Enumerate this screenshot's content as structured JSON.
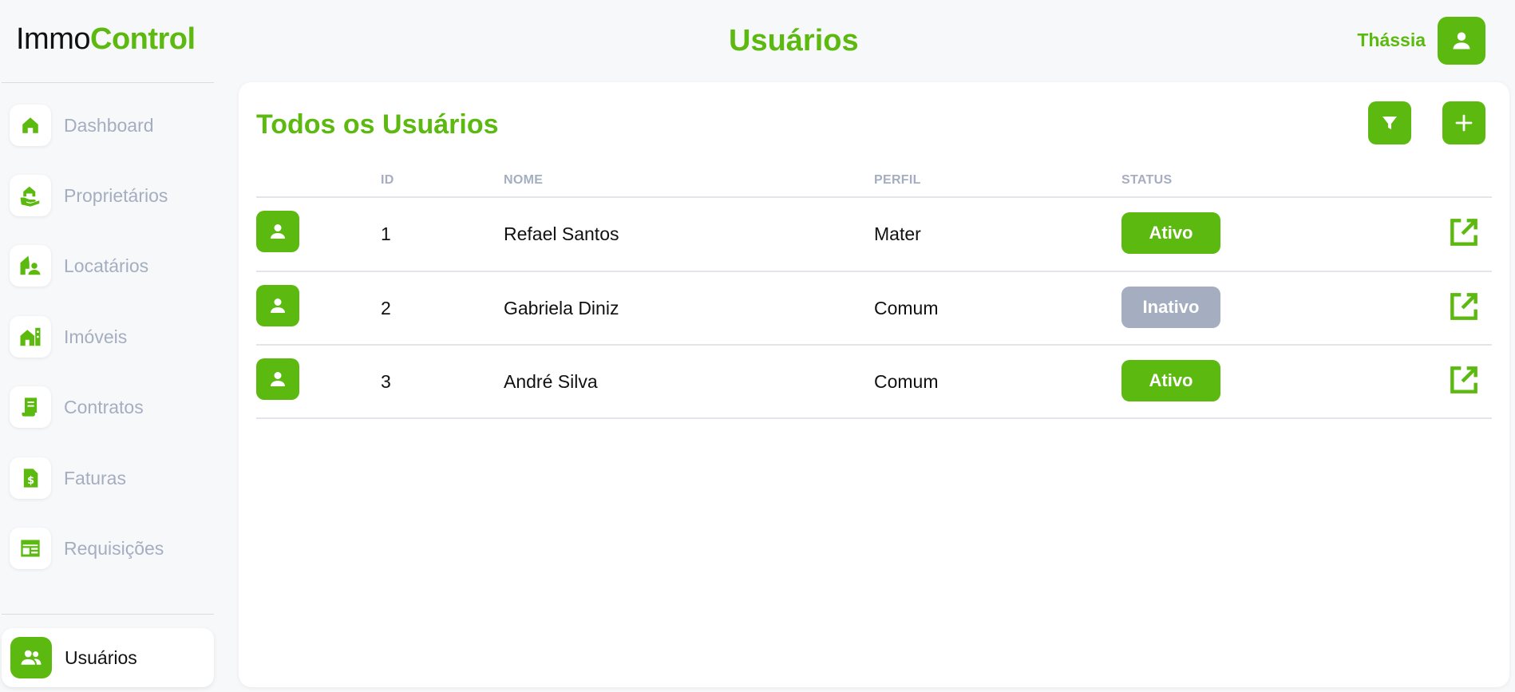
{
  "app": {
    "logo_part1": "Immo",
    "logo_part2": "Control"
  },
  "header": {
    "title": "Usuários",
    "user_name": "Thássia"
  },
  "sidebar": {
    "items": [
      {
        "label": "Dashboard",
        "icon": "home-icon"
      },
      {
        "label": "Proprietários",
        "icon": "owner-hand-house-icon"
      },
      {
        "label": "Locatários",
        "icon": "tenant-house-person-icon"
      },
      {
        "label": "Imóveis",
        "icon": "building-icon"
      },
      {
        "label": "Contratos",
        "icon": "contract-scroll-icon"
      },
      {
        "label": "Faturas",
        "icon": "invoice-dollar-icon"
      },
      {
        "label": "Requisições",
        "icon": "requests-table-icon"
      }
    ],
    "active": {
      "label": "Usuários",
      "icon": "users-group-icon"
    }
  },
  "main": {
    "title": "Todos os Usuários",
    "columns": {
      "id": "ID",
      "name": "NOME",
      "profile": "PERFIL",
      "status": "STATUS"
    },
    "rows": [
      {
        "id": "1",
        "name": "Refael Santos",
        "profile": "Mater",
        "status": "Ativo"
      },
      {
        "id": "2",
        "name": "Gabriela Diniz",
        "profile": "Comum",
        "status": "Inativo"
      },
      {
        "id": "3",
        "name": "André Silva",
        "profile": "Comum",
        "status": "Ativo"
      }
    ]
  },
  "colors": {
    "accent": "#5cb90f",
    "muted": "#a4aec0",
    "inactive_badge": "#a4aec0"
  }
}
